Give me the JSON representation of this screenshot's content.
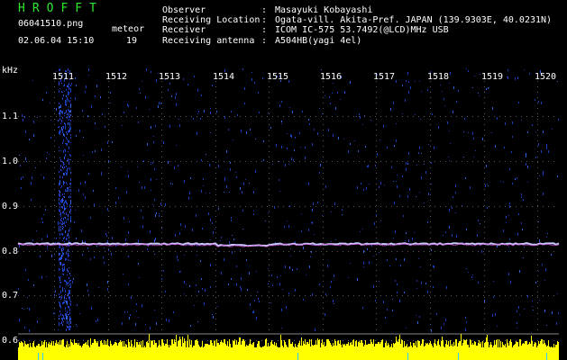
{
  "header": {
    "app_title": "HROFFT",
    "filename": "06041510.png",
    "datetime": "02.06.04 15:10",
    "meteor_label": "meteor",
    "meteor_count": "19"
  },
  "info": [
    {
      "label": "Observer",
      "value": "Masayuki Kobayashi"
    },
    {
      "label": "Receiving Location",
      "value": "Ogata-vill. Akita-Pref. JAPAN (139.9303E, 40.0231N)"
    },
    {
      "label": "Receiver",
      "value": "ICOM IC-575 53.7492(@LCD)MHz USB"
    },
    {
      "label": "Receiving antenna",
      "value": "A504HB(yagi 4el)"
    }
  ],
  "axis": {
    "y_unit": "kHz",
    "y_ticks": [
      "1.1",
      "1.0",
      "0.9",
      "0.8",
      "0.7",
      "0.6"
    ],
    "x_ticks": [
      "1511",
      "1512",
      "1513",
      "1514",
      "1515",
      "1516",
      "1517",
      "1518",
      "1519",
      "1520"
    ]
  },
  "colors": {
    "title_green": "#2ee82e",
    "signal_line": "#c8c8ff",
    "level_bar": "#ffff00",
    "noise": "#1a3dbf"
  }
}
